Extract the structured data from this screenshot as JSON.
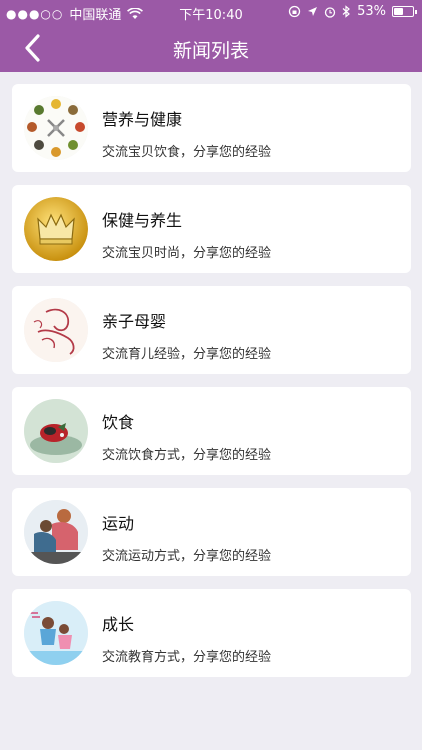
{
  "status_bar": {
    "carrier": "中国联通",
    "time": "下午10:40",
    "battery_percent": "53%",
    "battery_level": 0.53,
    "icons": [
      "signal-dots-icon",
      "wifi-icon",
      "lock-rotation-icon",
      "location-arrow-icon",
      "alarm-icon",
      "bluetooth-icon",
      "battery-icon"
    ]
  },
  "navbar": {
    "title": "新闻列表",
    "back_icon": "chevron-left-icon",
    "color": "#9b59a6"
  },
  "items": [
    {
      "title": "营养与健康",
      "desc": "交流宝贝饮食，分享您的经验",
      "image": "nutrition-plates-thumbnail"
    },
    {
      "title": "保健与养生",
      "desc": "交流宝贝时尚，分享您的经验",
      "image": "gold-crown-thumbnail"
    },
    {
      "title": "亲子母婴",
      "desc": "交流育儿经验，分享您的经验",
      "image": "mother-baby-sketch-thumbnail"
    },
    {
      "title": "饮食",
      "desc": "交流饮食方式，分享您的经验",
      "image": "food-dish-thumbnail"
    },
    {
      "title": "运动",
      "desc": "交流运动方式，分享您的经验",
      "image": "exercise-people-thumbnail"
    },
    {
      "title": "成长",
      "desc": "交流教育方式，分享您的经验",
      "image": "growth-kids-thumbnail"
    }
  ]
}
